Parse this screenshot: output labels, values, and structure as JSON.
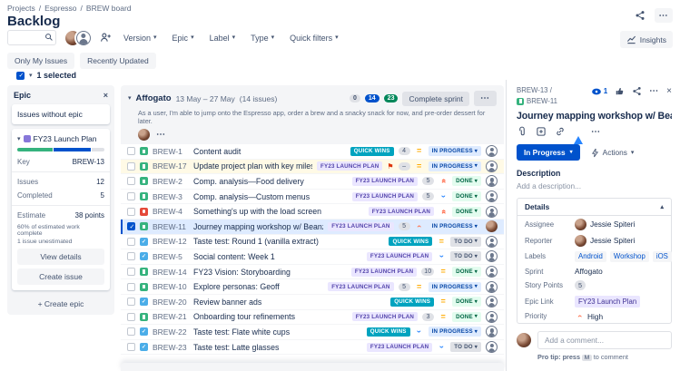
{
  "app": {
    "breadcrumb": [
      "Projects",
      "Espresso",
      "BREW board"
    ],
    "title": "Backlog"
  },
  "toolbar": {
    "search_placeholder": "",
    "filters": [
      "Version",
      "Epic",
      "Label",
      "Type",
      "Quick filters"
    ],
    "chips": [
      "Only My Issues",
      "Recently Updated"
    ],
    "insights_label": "Insights",
    "selected_text": "1 selected"
  },
  "epic_panel": {
    "title": "Epic",
    "no_epic": "Issues without epic",
    "epic_name": "FY23 Launch Plan",
    "progress": [
      {
        "color": "#36B37E",
        "pct": 42
      },
      {
        "color": "#0052CC",
        "pct": 43
      },
      {
        "color": "#DFE1E6",
        "pct": 15
      }
    ],
    "fields": [
      {
        "label": "Key",
        "value": "BREW-13"
      },
      {
        "label": "Issues",
        "value": "12"
      },
      {
        "label": "Completed",
        "value": "5"
      },
      {
        "label": "Estimate",
        "value": "38 points"
      }
    ],
    "notes": [
      "60% of estimated work complete",
      "1 issue unestimated"
    ],
    "view_details": "View details",
    "create_issue": "Create issue",
    "create_epic": "+ Create epic"
  },
  "sprint": {
    "name": "Affogato",
    "dates": "13 May – 27 May",
    "count": "(14 issues)",
    "badges": {
      "todo": "0",
      "in_progress": "14",
      "done": "23"
    },
    "complete_label": "Complete sprint",
    "goal": "As a user, I'm able to jump onto the Espresso app, order a brew and a snacky snack for now, and pre-order dessert for later.",
    "issues": [
      {
        "key": "BREW-1",
        "title": "Content audit",
        "type": "story",
        "epic": "QUICK WINS",
        "estimate": "4",
        "priority": "medium",
        "status": "IN PROGRESS"
      },
      {
        "key": "BREW-17",
        "title": "Update project plan with key milestones",
        "type": "story",
        "epic": "FY23 LAUNCH PLAN",
        "estimate": "–",
        "priority": "medium",
        "status": "IN PROGRESS",
        "state": "flagged"
      },
      {
        "key": "BREW-2",
        "title": "Comp. analysis—Food delivery",
        "type": "story",
        "epic": "FY23 LAUNCH PLAN",
        "estimate": "5",
        "priority": "highest",
        "status": "DONE"
      },
      {
        "key": "BREW-3",
        "title": "Comp. analysis—Custom menus",
        "type": "story",
        "epic": "FY23 LAUNCH PLAN",
        "estimate": "5",
        "priority": "low",
        "status": "DONE"
      },
      {
        "key": "BREW-4",
        "title": "Something's up with the load screen",
        "type": "bug",
        "epic": "FY23 LAUNCH PLAN",
        "estimate": null,
        "priority": "highest",
        "status": "DONE"
      },
      {
        "key": "BREW-11",
        "title": "Journey mapping workshop w/ Beanz",
        "type": "story",
        "epic": "FY23 LAUNCH PLAN",
        "estimate": "5",
        "priority": "high",
        "status": "IN PROGRESS",
        "state": "selected",
        "avatar": "photo"
      },
      {
        "key": "BREW-12",
        "title": "Taste test: Round 1 (vanilla extract)",
        "type": "task",
        "epic": "QUICK WINS",
        "estimate": null,
        "priority": "medium",
        "status": "TO DO"
      },
      {
        "key": "BREW-5",
        "title": "Social content: Week 1",
        "type": "task",
        "epic": "FY23 LAUNCH PLAN",
        "estimate": null,
        "priority": "low",
        "status": "TO DO"
      },
      {
        "key": "BREW-14",
        "title": "FY23 Vision: Storyboarding",
        "type": "story",
        "epic": "FY23 LAUNCH PLAN",
        "estimate": "10",
        "priority": "medium",
        "status": "DONE"
      },
      {
        "key": "BREW-10",
        "title": "Explore personas: Geoff",
        "type": "story",
        "epic": "FY23 LAUNCH PLAN",
        "estimate": "5",
        "priority": "medium",
        "status": "IN PROGRESS"
      },
      {
        "key": "BREW-20",
        "title": "Review banner ads",
        "type": "task",
        "epic": "QUICK WINS",
        "estimate": null,
        "priority": "medium",
        "status": "DONE"
      },
      {
        "key": "BREW-21",
        "title": "Onboarding tour refinements",
        "type": "story",
        "epic": "FY23 LAUNCH PLAN",
        "estimate": "3",
        "priority": "medium",
        "status": "DONE"
      },
      {
        "key": "BREW-22",
        "title": "Taste test: Flate white cups",
        "type": "task",
        "epic": "QUICK WINS",
        "estimate": null,
        "priority": "low",
        "status": "IN PROGRESS"
      },
      {
        "key": "BREW-23",
        "title": "Taste test: Latte glasses",
        "type": "task",
        "epic": "FY23 LAUNCH PLAN",
        "estimate": null,
        "priority": "low",
        "status": "TO DO"
      }
    ]
  },
  "detail_panel": {
    "parent_key": "BREW-13",
    "key": "BREW-11",
    "watchers": "1",
    "title": "Journey mapping workshop w/ Beanz",
    "status": "In Progress",
    "actions_label": "Actions",
    "description_label": "Description",
    "description_placeholder": "Add a description...",
    "details_title": "Details",
    "assignee_label": "Assignee",
    "assignee": "Jessie Spiteri",
    "reporter_label": "Reporter",
    "reporter": "Jessie Spiteri",
    "labels_label": "Labels",
    "labels": [
      "Android",
      "Workshop",
      "iOS"
    ],
    "sprint_label": "Sprint",
    "sprint": "Affogato",
    "points_label": "Story Points",
    "points": "5",
    "epic_label": "Epic Link",
    "epic": "FY23 Launch Plan",
    "priority_label": "Priority",
    "priority": "High",
    "comment_placeholder": "Add a comment...",
    "protip_prefix": "Pro tip: press",
    "protip_key": "M",
    "protip_suffix": "to comment"
  },
  "colors": {
    "accent": "#0052CC",
    "story": "#36B37E",
    "task": "#4BADE8",
    "bug": "#E5493A",
    "epic_purple": "#8777D9",
    "quick_wins_badge": "#00A3BF",
    "fy23_badge_bg": "#EAE6FF",
    "in_progress_bg": "#DEEBFF",
    "done_bg": "#E3FCEF",
    "todo_bg": "#DFE1E6",
    "done_count": "#00875A",
    "flag": "#DE350B",
    "flagged_row": "#FFFAE6",
    "selected_row": "#DEEBFF"
  }
}
